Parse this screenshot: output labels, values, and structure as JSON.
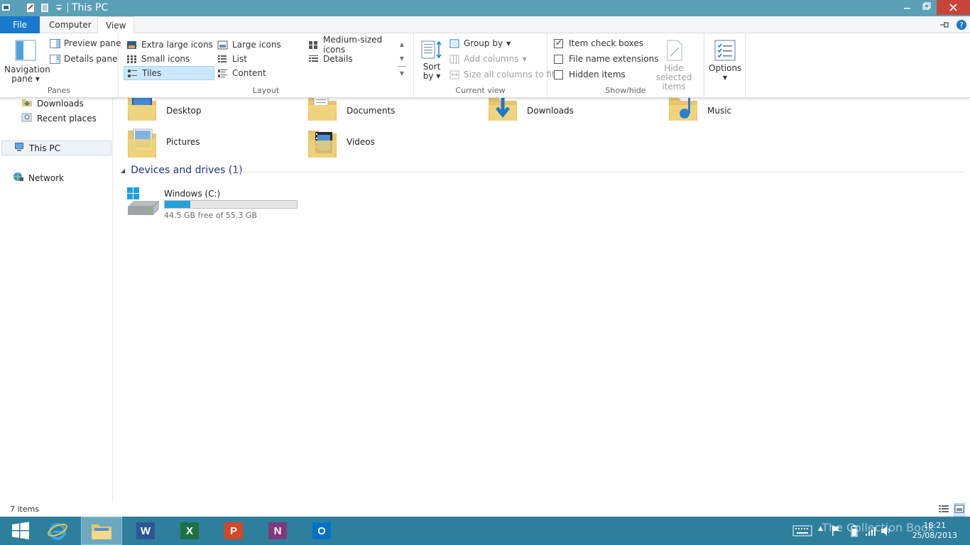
{
  "window": {
    "title": "This PC"
  },
  "tabs": {
    "file": "File",
    "computer": "Computer",
    "view": "View"
  },
  "ribbon": {
    "panes": {
      "nav_line1": "Navigation",
      "nav_line2": "pane",
      "preview": "Preview pane",
      "details": "Details pane",
      "label": "Panes"
    },
    "layout": {
      "items": [
        "Extra large icons",
        "Large icons",
        "Medium-sized icons",
        "Small icons",
        "List",
        "Details",
        "Tiles",
        "Content"
      ],
      "selected": "Tiles",
      "label": "Layout"
    },
    "current_view": {
      "sort_line1": "Sort",
      "sort_line2": "by",
      "group_by": "Group by",
      "add_columns": "Add columns",
      "size_columns": "Size all columns to fit",
      "label": "Current view"
    },
    "show_hide": {
      "item_check_boxes": "Item check boxes",
      "item_check_boxes_checked": true,
      "file_name_extensions": "File name extensions",
      "file_name_extensions_checked": false,
      "hidden_items": "Hidden items",
      "hidden_items_checked": false,
      "hide_selected_line1": "Hide selected",
      "hide_selected_line2": "items",
      "label": "Show/hide"
    },
    "options": {
      "label": "Options"
    }
  },
  "nav": {
    "items": [
      "Downloads",
      "Recent places",
      "This PC",
      "Network"
    ],
    "selected": "This PC"
  },
  "folders": [
    "Desktop",
    "Documents",
    "Downloads",
    "Music",
    "Pictures",
    "Videos"
  ],
  "devices": {
    "header": "Devices and drives (1)",
    "drive_name": "Windows (C:)",
    "drive_free_text": "44.5 GB free of 55.3 GB",
    "used_fraction": 0.195
  },
  "status": {
    "items": "7 items"
  },
  "taskbar": {
    "apps": [
      "start",
      "internet-explorer",
      "file-explorer",
      "word",
      "excel",
      "powerpoint",
      "onenote",
      "outlook"
    ],
    "time": "18:21",
    "date": "25/08/2013",
    "watermark": "The Collection Book"
  },
  "colors": {
    "titlebar": "#5ba0b6",
    "file_tab": "#1979ca",
    "taskbar": "#2d7f9c",
    "drive_fill": "#26a0da",
    "section_header": "#1e3287"
  }
}
